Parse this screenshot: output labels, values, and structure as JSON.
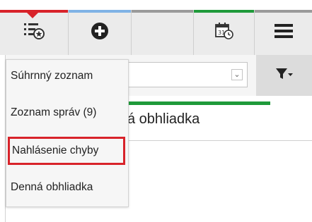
{
  "toolbar": {
    "buttons": [
      {
        "icon": "list-star-icon",
        "accent": "#d8232a"
      },
      {
        "icon": "add-circle-icon",
        "accent": "#7fb2e5"
      },
      {
        "icon": "blank",
        "accent": "#9a9a9a"
      },
      {
        "icon": "calendar-clock-icon",
        "accent": "#1f9a3a"
      },
      {
        "icon": "hamburger-menu-icon",
        "accent": "#9a9a9a"
      }
    ]
  },
  "background": {
    "select_value": "",
    "title_fragment": "á obhliadka"
  },
  "menu": {
    "items": [
      {
        "label": "Súhrnný zoznam"
      },
      {
        "label": "Zoznam správ (9)"
      },
      {
        "label": "Nahlásenie chyby"
      },
      {
        "label": "Denná obhliadka"
      }
    ]
  }
}
